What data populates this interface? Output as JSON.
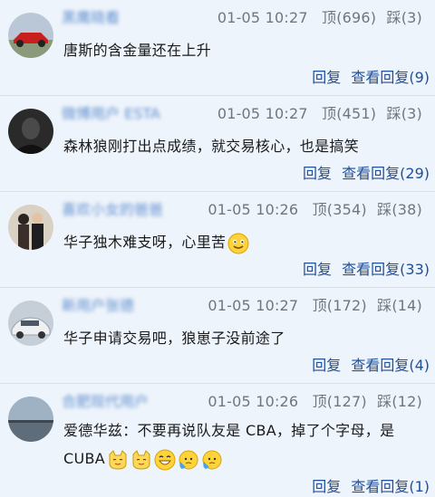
{
  "comments": [
    {
      "username": "黑鹰晓看",
      "time": "01-05 10:27",
      "up": "顶(696)",
      "down": "踩(3)",
      "text": "唐斯的含金量还在上升",
      "reply": "回复",
      "view_replies": "查看回复(9)"
    },
    {
      "username": "微博用户 ESTA",
      "time": "01-05 10:27",
      "up": "顶(451)",
      "down": "踩(3)",
      "text": "森林狼刚打出点成绩，就交易核心，也是搞笑",
      "reply": "回复",
      "view_replies": "查看回复(29)"
    },
    {
      "username": "喜欢小女的爸爸",
      "time": "01-05 10:26",
      "up": "顶(354)",
      "down": "踩(38)",
      "text": "华子独木难支呀，心里苦",
      "reply": "回复",
      "view_replies": "查看回复(33)"
    },
    {
      "username": "新用户张德",
      "time": "01-05 10:27",
      "up": "顶(172)",
      "down": "踩(14)",
      "text": "华子申请交易吧，狼崽子没前途了",
      "reply": "回复",
      "view_replies": "查看回复(4)"
    },
    {
      "username": "合肥现代用户",
      "time": "01-05 10:26",
      "up": "顶(127)",
      "down": "踩(12)",
      "text": "爱德华兹：不要再说队友是 CBA，掉了个字母，是 CUBA",
      "reply": "回复",
      "view_replies": "查看回复(1)"
    }
  ],
  "icons": {
    "smile": "smile-emoji-icon",
    "cat": "cat-emoji-icon",
    "grin": "grin-emoji-icon",
    "worried": "worried-emoji-icon"
  },
  "colors": {
    "background": "#eef4fb",
    "link": "#1f4f9c",
    "username": "#3b74c4",
    "meta": "#6f7680"
  }
}
